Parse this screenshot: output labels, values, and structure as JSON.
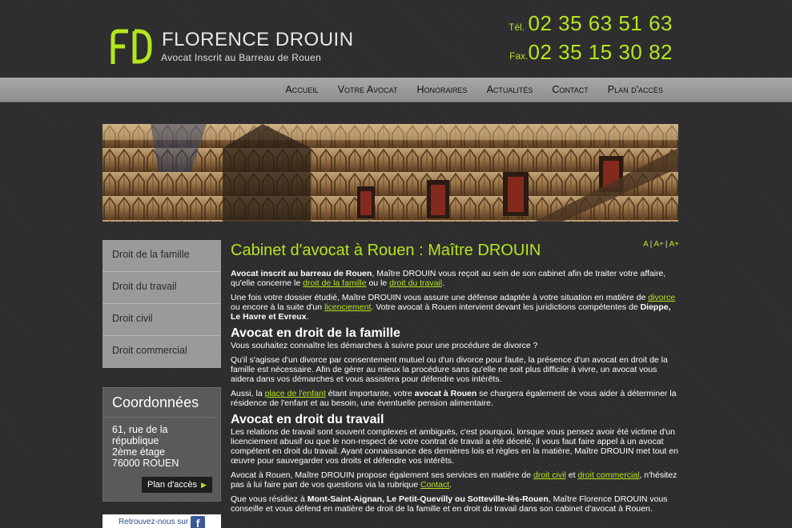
{
  "header": {
    "brand_name": "FLORENCE DROUIN",
    "brand_sub": "Avocat Inscrit au Barreau de Rouen",
    "logo_text": "FD",
    "phone_label": "Tél.",
    "phone": "02 35 63 51 63",
    "fax_label": "Fax.",
    "fax": "02 35 15 30 82"
  },
  "nav": [
    "Accueil",
    "Votre Avocat",
    "Honoraires",
    "Actualités",
    "Contact",
    "Plan d'accès"
  ],
  "sidebar": {
    "items": [
      "Droit de la famille",
      "Droit du travail",
      "Droit civil",
      "Droit commercial"
    ],
    "coords_title": "Coordonnées",
    "address_lines": [
      "61, rue de la",
      "république",
      "2ème étage",
      "76000 ROUEN"
    ],
    "plan_button": "Plan d'accès",
    "facebook_text": "Retrouvez-nous sur"
  },
  "main": {
    "title": "Cabinet d'avocat à Rouen : Maître DROUIN",
    "font_tools": [
      "A",
      "A+",
      "A+"
    ],
    "p1_bold": "Avocat inscrit au barreau de Rouen",
    "p1_rest": ", Maître DROUIN vous reçoit au sein de son cabinet afin de traiter votre affaire, qu'elle concerne le ",
    "p1_link1": "droit de la famille",
    "p1_mid": " ou le ",
    "p1_link2": "droit du travail",
    "p1_end": ".",
    "p2_a": "Une fois votre dossier étudié, Maître DROUIN vous assure une défense adaptée à votre situation en matière de ",
    "p2_link1": "divorce",
    "p2_b": " ou encore à la suite d'un ",
    "p2_link2": "licenciement",
    "p2_c": ". Votre avocat à Rouen intervient devant les juridictions compétentes de ",
    "p2_bold": "Dieppe, Le Havre et Evreux",
    "p2_end": ".",
    "h_famille": "Avocat en droit de la famille",
    "q_famille": "Vous souhaitez connaître les démarches à suivre pour une procédure de divorce ?",
    "p3": "Qu'il s'agisse d'un divorce par consentement mutuel ou d'un divorce pour faute, la présence d'un avocat en droit de la famille est nécessaire. Afin de gérer au mieux la procédure sans qu'elle ne soit plus difficile à vivre, un avocat vous aidera dans vos démarches et vous assistera pour défendre vos intérêts.",
    "p4_a": "Aussi, la ",
    "p4_link": "place de l'enfant",
    "p4_b": " étant importante, votre ",
    "p4_bold": "avocat à Rouen",
    "p4_c": " se chargera également de vous aider à déterminer la résidence de l'enfant et au besoin, une éventuelle pension alimentaire.",
    "h_travail": "Avocat en droit du travail",
    "p5": "Les relations de travail sont souvent complexes et ambiguës, c'est pourquoi, lorsque vous pensez avoir été victime d'un licenciement abusif ou que le non-respect de votre contrat de travail a été décelé, il vous faut faire appel à un avocat compétent en droit du travail. Ayant connaissance des dernières lois et règles en la matière, Maître DROUIN met tout en œuvre pour sauvegarder vos droits et défendre vos intérêts.",
    "p6_a": "Avocat à Rouen, Maître DROUIN propose également ses services en matière de ",
    "p6_link1": "droit civil",
    "p6_b": " et ",
    "p6_link2": "droit commercial",
    "p6_c": ", n'hésitez pas à lui faire part de vos questions via la rubrique ",
    "p6_link3": "Contact",
    "p6_end": ".",
    "p7_a": "Que vous résidiez à ",
    "p7_bold": "Mont-Saint-Aignan, Le Petit-Quevilly ou Sotteville-lès-Rouen",
    "p7_b": ", Maître Florence DROUIN vous conseille et vous défend en matière de droit de la famille et en droit du travail dans son cabinet d'avocat à Rouen."
  },
  "colors": {
    "accent": "#b5e61d",
    "background": "#2d2d2d",
    "nav": "#9a9a9a",
    "sidebar": "#9a9a9a",
    "coords": "#5a5a5a"
  }
}
